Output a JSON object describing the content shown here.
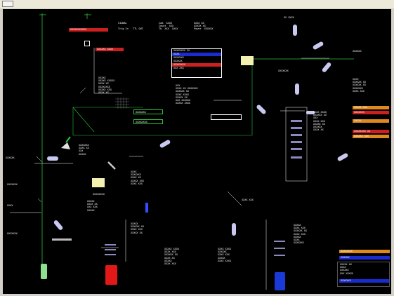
{
  "window": {
    "menu_button_label": ""
  },
  "colors": {
    "red": "#cc1f1f",
    "blue": "#1a2ccf",
    "orange": "#e08a1e",
    "green": "#2bc23b",
    "lightyellow": "#f3f0b0",
    "lens": "#c8c8f0"
  },
  "labels": {
    "top_left": [
      "SIGNAL",
      "",
      "Trig In   TTL OUT"
    ],
    "top_center": [
      "Cam  XXXX",
      "Count  XXX",
      "Tb  XXX  XXXX"
    ],
    "top_right": [
      "XXXX XX",
      "XXXXX XX",
      "Power  XXXXXX"
    ],
    "upper_right_lens": "XX XXXX",
    "laser_line": "XXXXXX",
    "right_col_top": [
      "XXXX",
      "XXXXXX XX",
      "XXXXXX XX",
      "XXXXXXX",
      "XXXX XXX"
    ],
    "mid_block": [
      "XXXXX",
      "XXXXX XXXXX",
      "XXXX XX",
      "XXXXXXXX",
      "XXXXX XXX",
      "XXXX XX"
    ],
    "center_box": [
      "XXX",
      "XXXX XX XXXXXXX",
      "XXXXXX XX",
      "XXXX XXXX",
      "XXXXX XX",
      "XXX XXXXXX",
      "XXXXX XXXX"
    ],
    "left_block": [
      "XXXXXXX",
      "XXXX XX",
      "XXX",
      "XXXXX"
    ],
    "left_edge": [
      "XXXXXX",
      "XXXXXXX",
      "XXXX",
      "XXXXXXX"
    ],
    "mid_lower": [
      "XXXX",
      "XXXXXXX",
      "XXXX XX",
      "XXXXX XXX",
      "XXXX XXX"
    ],
    "lower_center_left": [
      "XXXXX",
      "XXXXXX XX",
      "XXXX XXX",
      "XXXXX XX"
    ],
    "lower_center": [
      "XXXXX XXXX",
      "XXXX XXX",
      "XXXXXX XX",
      "XXXX XX",
      "XXXXX",
      "XXXX XXX"
    ],
    "lower_center2": [
      "XXXX XXXX",
      "XXXXXX",
      "XXXX XXX",
      "XXXXX",
      "XXXX XXXX"
    ],
    "lower_right": [
      "XXXXX",
      "XXXX XXX",
      "XXXXXX XX",
      "XXXX XXX",
      "XXXXX",
      "XXXX",
      "XXXXXXX"
    ],
    "bottom_left_box": [
      "XXXXX",
      "XXXX XX",
      "XXX XXX",
      "XXXXX"
    ],
    "right_list": [
      "XXXX XXXX",
      "XXXXXX XX",
      "XXX",
      "XXXX XXX",
      "XXXXX XX",
      "XXXXXX",
      "XXXX XX"
    ],
    "bottom_right_panel": [
      "XXXXX XX",
      "XXXX",
      "XXXXXX",
      "XXX XXXXX"
    ],
    "filter_label": "XXXXXXX",
    "pocket_label": "XXXX XXX",
    "beam_label": "XXXXXXXX"
  },
  "menu_panel": {
    "items": [
      {
        "label": "XXXXXXXX XX",
        "state": "normal"
      },
      {
        "label": "XXXX",
        "state": "blue"
      },
      {
        "label": "XXXXXXX",
        "state": "normal"
      },
      {
        "label": "XXXXXX",
        "state": "normal"
      },
      {
        "label": "XXXXXXXX",
        "state": "red"
      },
      {
        "label": "XXX     XXX",
        "state": "normal"
      }
    ]
  },
  "bars": {
    "top_left_red": "XXXXXXXXXXX",
    "mid_red": "XXXXXX XXXX",
    "right_orange_1": "XXXXX XXX",
    "right_red_1": "XXXXXXX",
    "right_orange_2": "XXXXX",
    "right_red_2": "XXXXXXXX XX",
    "right_orange_3": "XXXXXX XXX",
    "br_orange": "XXXXXXXX",
    "br_blue_1": "XXXXXX",
    "br_blue_2": "XXXXXXX"
  },
  "green_boxes": [
    "XXXXXXX",
    "XXXXXXXX"
  ]
}
